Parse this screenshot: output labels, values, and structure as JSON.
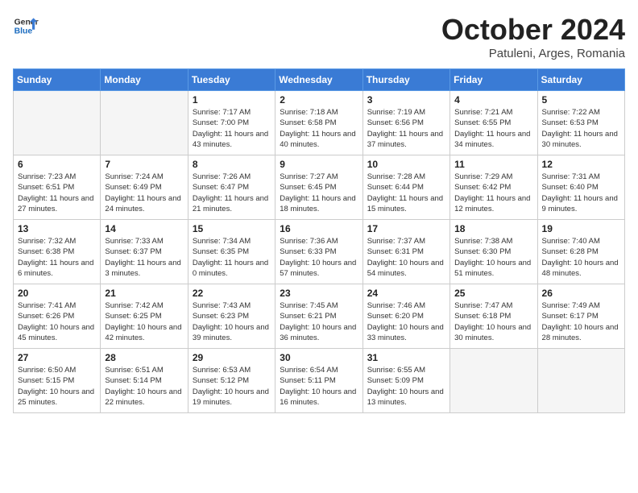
{
  "header": {
    "logo_line1": "General",
    "logo_line2": "Blue",
    "month": "October 2024",
    "location": "Patuleni, Arges, Romania"
  },
  "weekdays": [
    "Sunday",
    "Monday",
    "Tuesday",
    "Wednesday",
    "Thursday",
    "Friday",
    "Saturday"
  ],
  "weeks": [
    [
      {
        "day": "",
        "info": "",
        "empty": true
      },
      {
        "day": "",
        "info": "",
        "empty": true
      },
      {
        "day": "1",
        "info": "Sunrise: 7:17 AM\nSunset: 7:00 PM\nDaylight: 11 hours and 43 minutes."
      },
      {
        "day": "2",
        "info": "Sunrise: 7:18 AM\nSunset: 6:58 PM\nDaylight: 11 hours and 40 minutes."
      },
      {
        "day": "3",
        "info": "Sunrise: 7:19 AM\nSunset: 6:56 PM\nDaylight: 11 hours and 37 minutes."
      },
      {
        "day": "4",
        "info": "Sunrise: 7:21 AM\nSunset: 6:55 PM\nDaylight: 11 hours and 34 minutes."
      },
      {
        "day": "5",
        "info": "Sunrise: 7:22 AM\nSunset: 6:53 PM\nDaylight: 11 hours and 30 minutes."
      }
    ],
    [
      {
        "day": "6",
        "info": "Sunrise: 7:23 AM\nSunset: 6:51 PM\nDaylight: 11 hours and 27 minutes."
      },
      {
        "day": "7",
        "info": "Sunrise: 7:24 AM\nSunset: 6:49 PM\nDaylight: 11 hours and 24 minutes."
      },
      {
        "day": "8",
        "info": "Sunrise: 7:26 AM\nSunset: 6:47 PM\nDaylight: 11 hours and 21 minutes."
      },
      {
        "day": "9",
        "info": "Sunrise: 7:27 AM\nSunset: 6:45 PM\nDaylight: 11 hours and 18 minutes."
      },
      {
        "day": "10",
        "info": "Sunrise: 7:28 AM\nSunset: 6:44 PM\nDaylight: 11 hours and 15 minutes."
      },
      {
        "day": "11",
        "info": "Sunrise: 7:29 AM\nSunset: 6:42 PM\nDaylight: 11 hours and 12 minutes."
      },
      {
        "day": "12",
        "info": "Sunrise: 7:31 AM\nSunset: 6:40 PM\nDaylight: 11 hours and 9 minutes."
      }
    ],
    [
      {
        "day": "13",
        "info": "Sunrise: 7:32 AM\nSunset: 6:38 PM\nDaylight: 11 hours and 6 minutes."
      },
      {
        "day": "14",
        "info": "Sunrise: 7:33 AM\nSunset: 6:37 PM\nDaylight: 11 hours and 3 minutes."
      },
      {
        "day": "15",
        "info": "Sunrise: 7:34 AM\nSunset: 6:35 PM\nDaylight: 11 hours and 0 minutes."
      },
      {
        "day": "16",
        "info": "Sunrise: 7:36 AM\nSunset: 6:33 PM\nDaylight: 10 hours and 57 minutes."
      },
      {
        "day": "17",
        "info": "Sunrise: 7:37 AM\nSunset: 6:31 PM\nDaylight: 10 hours and 54 minutes."
      },
      {
        "day": "18",
        "info": "Sunrise: 7:38 AM\nSunset: 6:30 PM\nDaylight: 10 hours and 51 minutes."
      },
      {
        "day": "19",
        "info": "Sunrise: 7:40 AM\nSunset: 6:28 PM\nDaylight: 10 hours and 48 minutes."
      }
    ],
    [
      {
        "day": "20",
        "info": "Sunrise: 7:41 AM\nSunset: 6:26 PM\nDaylight: 10 hours and 45 minutes."
      },
      {
        "day": "21",
        "info": "Sunrise: 7:42 AM\nSunset: 6:25 PM\nDaylight: 10 hours and 42 minutes."
      },
      {
        "day": "22",
        "info": "Sunrise: 7:43 AM\nSunset: 6:23 PM\nDaylight: 10 hours and 39 minutes."
      },
      {
        "day": "23",
        "info": "Sunrise: 7:45 AM\nSunset: 6:21 PM\nDaylight: 10 hours and 36 minutes."
      },
      {
        "day": "24",
        "info": "Sunrise: 7:46 AM\nSunset: 6:20 PM\nDaylight: 10 hours and 33 minutes."
      },
      {
        "day": "25",
        "info": "Sunrise: 7:47 AM\nSunset: 6:18 PM\nDaylight: 10 hours and 30 minutes."
      },
      {
        "day": "26",
        "info": "Sunrise: 7:49 AM\nSunset: 6:17 PM\nDaylight: 10 hours and 28 minutes."
      }
    ],
    [
      {
        "day": "27",
        "info": "Sunrise: 6:50 AM\nSunset: 5:15 PM\nDaylight: 10 hours and 25 minutes."
      },
      {
        "day": "28",
        "info": "Sunrise: 6:51 AM\nSunset: 5:14 PM\nDaylight: 10 hours and 22 minutes."
      },
      {
        "day": "29",
        "info": "Sunrise: 6:53 AM\nSunset: 5:12 PM\nDaylight: 10 hours and 19 minutes."
      },
      {
        "day": "30",
        "info": "Sunrise: 6:54 AM\nSunset: 5:11 PM\nDaylight: 10 hours and 16 minutes."
      },
      {
        "day": "31",
        "info": "Sunrise: 6:55 AM\nSunset: 5:09 PM\nDaylight: 10 hours and 13 minutes."
      },
      {
        "day": "",
        "info": "",
        "empty": true
      },
      {
        "day": "",
        "info": "",
        "empty": true
      }
    ]
  ]
}
